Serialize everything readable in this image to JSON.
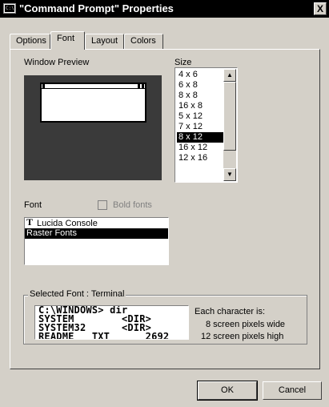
{
  "window": {
    "title": "\"Command Prompt\" Properties",
    "icon": "console-icon",
    "close_label": "X"
  },
  "tabs": [
    {
      "label": "Options",
      "active": false
    },
    {
      "label": "Font",
      "active": true
    },
    {
      "label": "Layout",
      "active": false
    },
    {
      "label": "Colors",
      "active": false
    }
  ],
  "preview": {
    "label": "Window Preview"
  },
  "size": {
    "label": "Size",
    "items": [
      "4 x 6",
      "6 x 8",
      "8 x 8",
      "16 x 8",
      "5 x 12",
      "7 x 12",
      "8 x 12",
      "16 x 12",
      "12 x 16"
    ],
    "selected": "8 x 12",
    "scroll_up": "▲",
    "scroll_down": "▼"
  },
  "font": {
    "label": "Font",
    "bold_label": "Bold fonts",
    "bold_checked": false,
    "bold_enabled": false,
    "items": [
      {
        "name": "Lucida Console",
        "icon": "truetype-icon"
      },
      {
        "name": "Raster Fonts",
        "icon": ""
      }
    ],
    "selected": "Raster Fonts"
  },
  "selected_font": {
    "label": "Selected Font : Terminal",
    "sample_lines": [
      "C:\\WINDOWS> dir",
      "SYSTEM        <DIR>",
      "SYSTEM32      <DIR>",
      "README   TXT      2692"
    ],
    "info_heading": "Each character is:",
    "width_line": "8 screen pixels wide",
    "height_line": "12 screen pixels high"
  },
  "buttons": {
    "ok": "OK",
    "cancel": "Cancel"
  },
  "colors": {
    "face": "#d4d0c8",
    "titlebar": "#000000",
    "selection": "#000000",
    "preview_bg": "#3a3a3a"
  }
}
